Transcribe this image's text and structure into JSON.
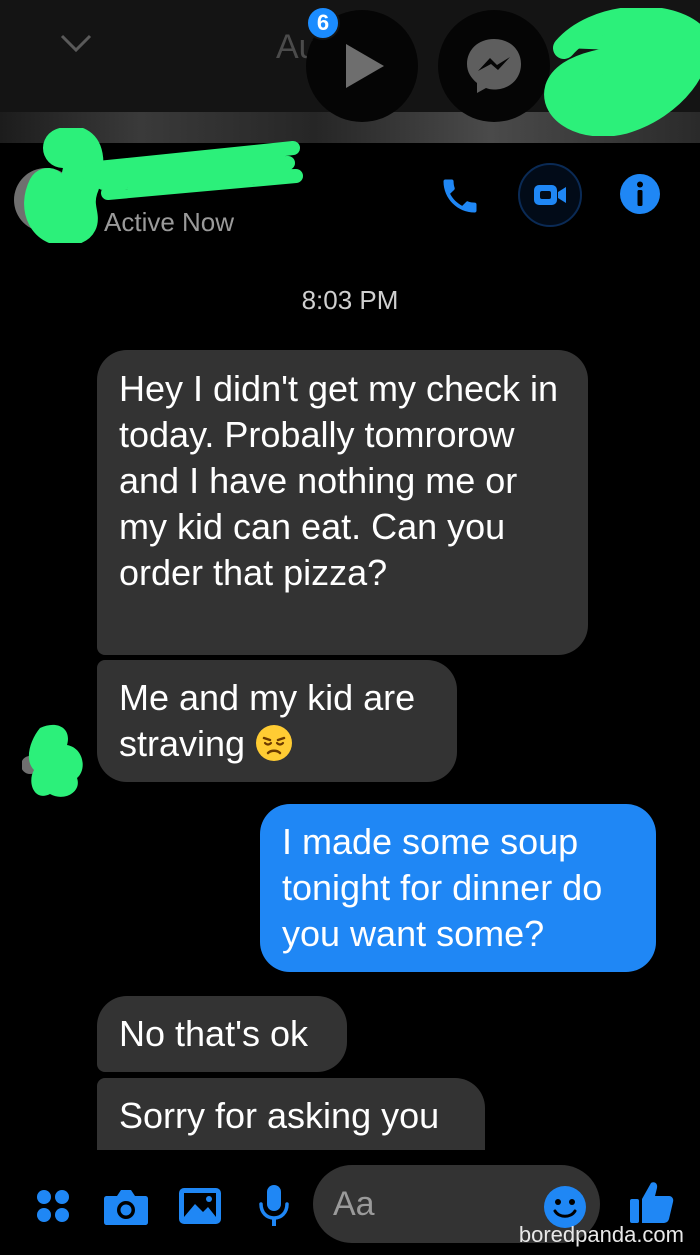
{
  "top_bar": {
    "faded_title": "Au",
    "badge_count": "6",
    "icons": [
      "chevron-down-icon",
      "play-icon",
      "messenger-icon"
    ]
  },
  "header": {
    "status": "Active Now",
    "actions": [
      "phone-icon",
      "video-icon",
      "info-icon"
    ]
  },
  "conversation": {
    "timestamp": "8:03 PM",
    "messages": [
      {
        "from": "them",
        "text": "Hey I didn't get my check in today. Probally tomrorow and I have nothing me or my kid can eat. Can you order that pizza?"
      },
      {
        "from": "them",
        "text": "Me and my kid are straving",
        "emoji": "disappointed-face"
      },
      {
        "from": "me",
        "text": "I made some soup tonight for dinner do you want some?"
      },
      {
        "from": "them",
        "text": "No that's ok"
      },
      {
        "from": "them",
        "text": "Sorry for asking you"
      }
    ]
  },
  "composer": {
    "placeholder": "Aa",
    "icons": [
      "more-icon",
      "camera-icon",
      "image-icon",
      "microphone-icon",
      "emoji-icon",
      "thumbs-up-icon"
    ]
  },
  "watermark": "boredpanda.com",
  "colors": {
    "accent": "#1f87f5",
    "incoming_bubble": "#333333",
    "background": "#000000",
    "redaction": "#2cf07a"
  }
}
